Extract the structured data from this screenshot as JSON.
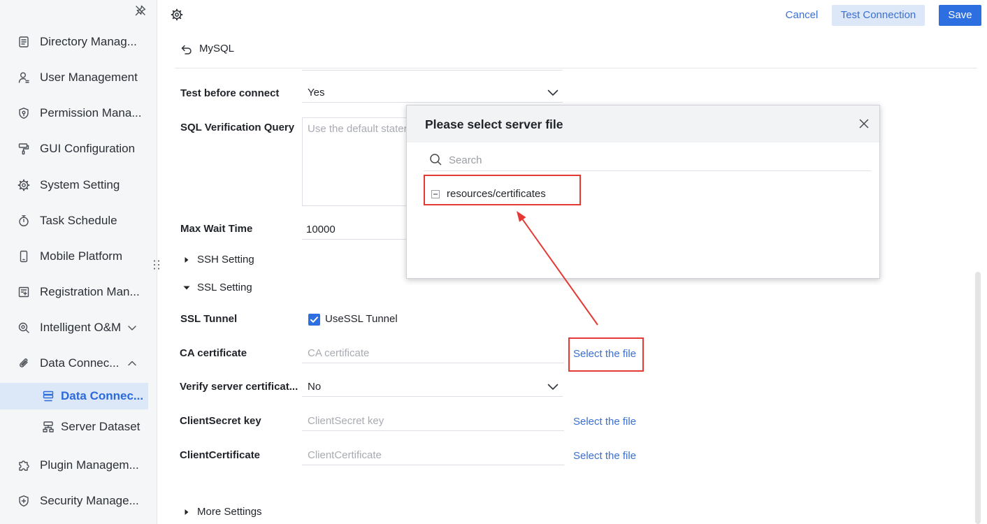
{
  "colors": {
    "accent": "#2d6ee0",
    "link": "#3b6fd4",
    "active_bg": "#dce7f7",
    "sidebar_bg": "#f5f6f8",
    "annotation": "#e53935"
  },
  "sidebar": {
    "pin_icon": "pin-icon",
    "drag_icon": "drag-handle-icon",
    "items": [
      {
        "label": "Directory Manag...",
        "icon": "directory-icon"
      },
      {
        "label": "User Management",
        "icon": "user-icon"
      },
      {
        "label": "Permission Mana...",
        "icon": "shield-icon"
      },
      {
        "label": "GUI Configuration",
        "icon": "paint-roller-icon"
      },
      {
        "label": "System Setting",
        "icon": "gear-icon"
      },
      {
        "label": "Task Schedule",
        "icon": "stopwatch-icon"
      },
      {
        "label": "Mobile Platform",
        "icon": "mobile-icon"
      },
      {
        "label": "Registration Man...",
        "icon": "registration-icon"
      },
      {
        "label": "Intelligent O&M",
        "icon": "om-icon",
        "expanded": false
      },
      {
        "label": "Data Connec...",
        "icon": "paperclip-icon",
        "expanded": true,
        "children": [
          {
            "label": "Data Connec...",
            "icon": "data-connection-icon",
            "active": true
          },
          {
            "label": "Server Dataset",
            "icon": "dataset-icon",
            "active": false
          }
        ]
      },
      {
        "label": "Plugin Managem...",
        "icon": "puzzle-icon"
      },
      {
        "label": "Security Manage...",
        "icon": "security-icon"
      }
    ]
  },
  "toolbar": {
    "settings_icon": "settings-icon",
    "cancel_label": "Cancel",
    "test_label": "Test Connection",
    "save_label": "Save"
  },
  "header": {
    "back_icon": "back-arrow-icon",
    "title": "MySQL"
  },
  "form": {
    "test_before_connect": {
      "label": "Test before connect",
      "value": "Yes"
    },
    "sql_verification_query": {
      "label": "SQL Verification Query",
      "placeholder": "Use the default stater"
    },
    "max_wait_time": {
      "label": "Max Wait Time",
      "value": "10000"
    },
    "ssh_setting": {
      "label": "SSH Setting",
      "expanded": false
    },
    "ssl_setting": {
      "label": "SSL Setting",
      "expanded": true
    },
    "ssl_tunnel": {
      "label": "SSL Tunnel",
      "checkbox_label": "UseSSL Tunnel",
      "checked": true
    },
    "ca_certificate": {
      "label": "CA certificate",
      "placeholder": "CA certificate",
      "action": "Select the file"
    },
    "verify_server_certificate": {
      "label": "Verify server certificat...",
      "value": "No"
    },
    "client_secret_key": {
      "label": "ClientSecret key",
      "placeholder": "ClientSecret key",
      "action": "Select the file"
    },
    "client_certificate": {
      "label": "ClientCertificate",
      "placeholder": "ClientCertificate",
      "action": "Select the file"
    },
    "more_settings": {
      "label": "More Settings",
      "expanded": false
    }
  },
  "dialog": {
    "title": "Please select server file",
    "close_icon": "close-icon",
    "search_icon": "search-icon",
    "search_placeholder": "Search",
    "tree": [
      {
        "label": "resources/certificates",
        "icon": "collapse-icon",
        "expanded": true
      }
    ]
  }
}
